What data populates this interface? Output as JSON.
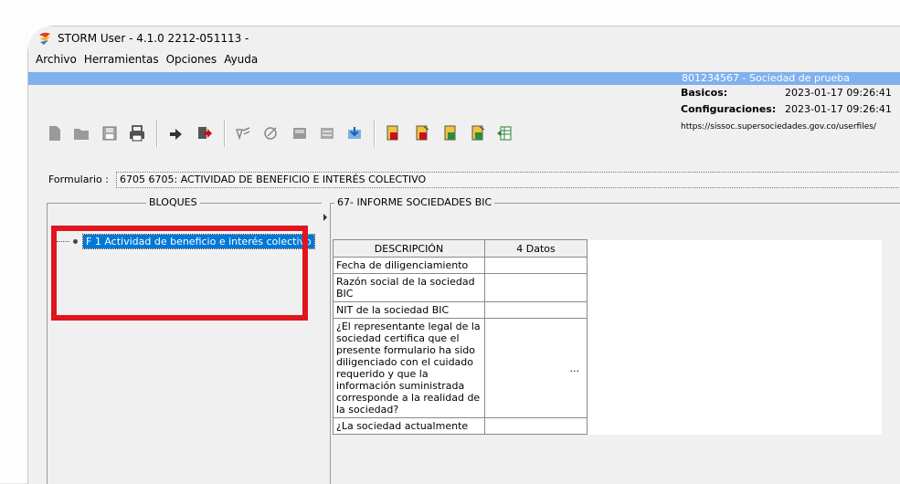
{
  "window": {
    "title": "STORM User - 4.1.0  2212-051113 -"
  },
  "menu": [
    "Archivo",
    "Herramientas",
    "Opciones",
    "Ayuda"
  ],
  "entity_bar": {
    "text": "801234567 - Sociedad de prueba"
  },
  "info": {
    "basicos_label": "Basicos:",
    "basicos_date": "2023-01-17 09:26:41",
    "config_label": "Configuraciones:",
    "config_date": "2023-01-17 09:26:41",
    "url": "https://sissoc.supersociedades.gov.co/userfiles/"
  },
  "toolbar_icons": [
    "new-icon",
    "open-icon",
    "save-icon",
    "print-icon",
    "import-icon",
    "export-icon",
    "validate-icon",
    "sign-icon",
    "send-icon",
    "report-icon",
    "download-icon",
    "pdf1-icon",
    "pdf2-icon",
    "pdf3-icon",
    "pdf4-icon",
    "grid-icon"
  ],
  "form": {
    "label": "Formulario :",
    "value": "6705 6705: ACTIVIDAD DE BENEFICIO E INTERÉS COLECTIVO"
  },
  "blocks": {
    "legend": "BLOQUES",
    "items": [
      "F 1 Actividad de beneficio e interés colectivo"
    ]
  },
  "report": {
    "legend": "67- INFORME SOCIEDADES BIC",
    "headers": [
      "DESCRIPCIÓN",
      "4 Datos"
    ],
    "rows": [
      {
        "desc": "Fecha de diligenciamiento",
        "value": ""
      },
      {
        "desc": "Razón social de la sociedad BIC",
        "value": ""
      },
      {
        "desc": "NIT de la sociedad BIC",
        "value": ""
      },
      {
        "desc": "¿El representante legal de la sociedad certifica que el presente formulario ha sido diligenciado con el cuidado requerido y que la información suministrada corresponde a la realidad de la sociedad?",
        "value": "..."
      },
      {
        "desc": "¿La sociedad actualmente",
        "value": ""
      }
    ]
  },
  "colors": {
    "selection": "#0078d7",
    "entity_bar": "#7fb1ee",
    "highlight": "#e0151e"
  }
}
